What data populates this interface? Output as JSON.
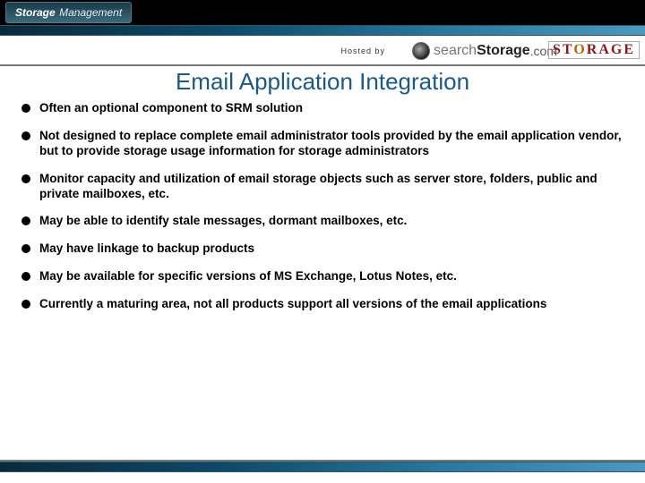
{
  "brand": {
    "strong": "Storage",
    "light": "Management"
  },
  "hosted_by": "Hosted by",
  "searchlogo": {
    "search": "search",
    "storage": "Storage",
    "com": ".com"
  },
  "storagelogo": "STORAGE",
  "title": "Email Application Integration",
  "bullets": [
    "Often an optional component to SRM solution",
    "Not designed to replace complete email administrator tools provided by the email application vendor, but to provide storage usage information for storage administrators",
    "Monitor capacity and utilization of email storage objects such as server store, folders, public and private mailboxes, etc.",
    "May be able to identify stale messages, dormant mailboxes, etc.",
    "May have linkage to backup products",
    "May be available for specific versions of MS Exchange, Lotus Notes, etc.",
    "Currently a maturing area, not all products support all versions of the email applications"
  ]
}
